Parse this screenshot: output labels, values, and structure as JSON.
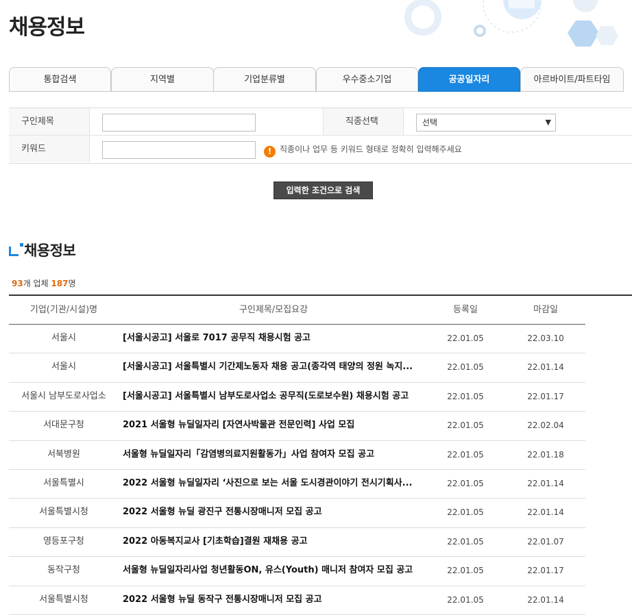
{
  "page": {
    "title": "채용정보"
  },
  "tabs": [
    {
      "label": "통합검색"
    },
    {
      "label": "지역별"
    },
    {
      "label": "기업분류별"
    },
    {
      "label": "우수중소기업"
    },
    {
      "label": "공공일자리",
      "active": true
    },
    {
      "label": "아르바이트/파트타임"
    }
  ],
  "search": {
    "title_label": "구인제목",
    "title_value": "",
    "job_label": "직종선택",
    "job_select_value": "선택",
    "keyword_label": "키워드",
    "keyword_value": "",
    "hint": "직종이나 업무 등 키워드 형태로 정확히 입력해주세요",
    "submit_label": "입력한 조건으로 검색"
  },
  "results": {
    "section_title": "채용정보",
    "count_companies": "93",
    "count_companies_unit": "개 업체",
    "count_people": "187",
    "count_people_unit": "명",
    "columns": {
      "org": "기업(기관/시설)명",
      "title": "구인제목/모집요강",
      "registered": "등록일",
      "deadline": "마감일"
    },
    "rows": [
      {
        "org": "서울시",
        "title": "[서울시공고] 서울로 7017 공무직 채용시험 공고",
        "registered": "22.01.05",
        "deadline": "22.03.10"
      },
      {
        "org": "서울시",
        "title": "[서울시공고] 서울특별시 기간제노동자 채용 공고(종각역 태양의 정원 녹지...",
        "registered": "22.01.05",
        "deadline": "22.01.14"
      },
      {
        "org": "서울시 남부도로사업소",
        "title": "[서울시공고] 서울특별시 남부도로사업소 공무직(도로보수원) 채용시험 공고",
        "registered": "22.01.05",
        "deadline": "22.01.17"
      },
      {
        "org": "서대문구청",
        "title": "2021 서울형 뉴딜일자리 [자연사박물관 전문인력] 사업 모집",
        "registered": "22.01.05",
        "deadline": "22.02.04"
      },
      {
        "org": "서북병원",
        "title": "서울형 뉴딜일자리「감염병의료지원활동가」사업 참여자 모집 공고",
        "registered": "22.01.05",
        "deadline": "22.01.18"
      },
      {
        "org": "서울특별시",
        "title": "2022 서울형 뉴딜일자리 ‘사진으로 보는 서울 도시경관이야기 전시기획사...",
        "registered": "22.01.05",
        "deadline": "22.01.14"
      },
      {
        "org": "서울특별시청",
        "title": "2022 서울형 뉴딜 광진구 전통시장매니저 모집 공고",
        "registered": "22.01.05",
        "deadline": "22.01.14"
      },
      {
        "org": "영등포구청",
        "title": "2022 아동복지교사 [기초학습]결원 재채용 공고",
        "registered": "22.01.05",
        "deadline": "22.01.07"
      },
      {
        "org": "동작구청",
        "title": "서울형 뉴딜일자리사업 청년활동ON, 유스(Youth) 매니저 참여자 모집 공고",
        "registered": "22.01.05",
        "deadline": "22.01.17"
      },
      {
        "org": "서울특별시청",
        "title": "2022 서울형 뉴딜 동작구 전통시장매니저 모집 공고",
        "registered": "22.01.05",
        "deadline": "22.01.14"
      }
    ]
  },
  "colors": {
    "accent": "#1a87e0",
    "count_highlight": "#e06a10",
    "warning": "#f57c00",
    "button_dark": "#4a4a4a"
  }
}
